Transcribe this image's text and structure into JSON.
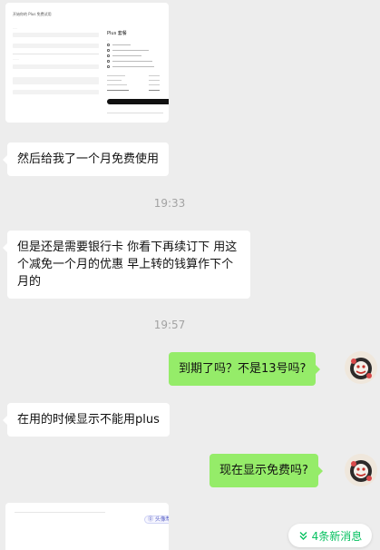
{
  "messages": {
    "image1": {
      "header_label": "开始你的 Plus 免费试用",
      "panel_title": "Plus 套餐"
    },
    "recv1": "然后给我了一个月免费使用",
    "time1": "19:33",
    "recv2": "但是还是需要银行卡 你看下再续订下 用这个减免一个月的优惠 早上转的钱算作下个月的",
    "time2": "19:57",
    "sent1": "到期了吗？不是13号吗?",
    "recv3": "在用的时候显示不能用plus",
    "sent2": "现在显示免费吗?",
    "image2": {
      "chip_label": "⓪ 头像帮助"
    }
  },
  "new_messages_button": {
    "label": "4条新消息",
    "icon": "double-chevron-down-icon"
  },
  "colors": {
    "background": "#ededed",
    "received_bubble": "#ffffff",
    "sent_bubble": "#95ec69",
    "new_message_accent": "#07c160",
    "time_text": "#a3a3a3"
  }
}
